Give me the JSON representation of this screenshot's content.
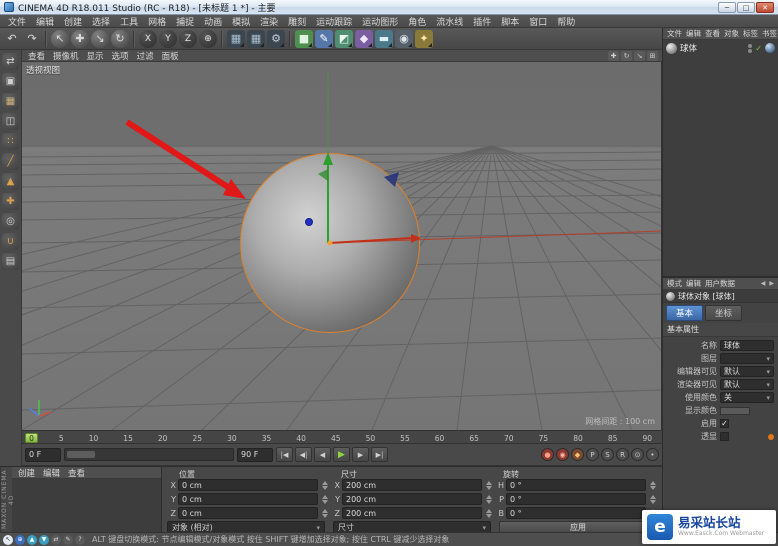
{
  "window": {
    "title": "CINEMA 4D R18.011 Studio (RC - R18) - [未标题 1 *] - 主要",
    "controls": {
      "min": "─",
      "max": "□",
      "close": "✕"
    }
  },
  "menubar": {
    "items": [
      "文件",
      "编辑",
      "创建",
      "选择",
      "工具",
      "网格",
      "捕捉",
      "动画",
      "模拟",
      "渲染",
      "雕刻",
      "运动跟踪",
      "运动图形",
      "角色",
      "流水线",
      "插件",
      "脚本",
      "窗口",
      "帮助"
    ]
  },
  "toolbar": {
    "buttons": [
      {
        "name": "undo-button",
        "g": "↶"
      },
      {
        "name": "redo-button",
        "g": "↷"
      },
      {
        "sep": true
      },
      {
        "name": "live-selection-button",
        "g": "↖",
        "circle": true
      },
      {
        "name": "move-tool-button",
        "g": "✚",
        "circle": true
      },
      {
        "name": "scale-tool-button",
        "g": "↘",
        "circle": true
      },
      {
        "name": "rotate-tool-button",
        "g": "↻",
        "circle": true
      },
      {
        "sep": true
      },
      {
        "name": "lock-x-axis-button",
        "g": "X",
        "circle": true,
        "dark": true
      },
      {
        "name": "lock-y-axis-button",
        "g": "Y",
        "circle": true,
        "dark": true
      },
      {
        "name": "lock-z-axis-button",
        "g": "Z",
        "circle": true,
        "dark": true
      },
      {
        "name": "coordinate-system-button",
        "g": "⊕",
        "circle": true,
        "dark": true
      },
      {
        "sep": true
      },
      {
        "name": "render-view-button",
        "g": "▦",
        "bg": "#3c4650",
        "fg": "#a8c0d2",
        "pal": true
      },
      {
        "name": "render-picture-viewer-button",
        "g": "▦",
        "bg": "#3c4650",
        "fg": "#a8c0d2",
        "pal": true
      },
      {
        "name": "render-settings-button",
        "g": "⚙",
        "bg": "#3c4650",
        "fg": "#c2cfd8",
        "pal": true
      },
      {
        "sep": true
      },
      {
        "name": "add-cube-button",
        "g": "■",
        "bg": "#4f8f4f",
        "fg": "#e2f2e2",
        "pal": true
      },
      {
        "name": "add-spline-button",
        "g": "✎",
        "bg": "#5577aa",
        "fg": "#ffffff",
        "pal": true
      },
      {
        "name": "add-subdivision-button",
        "g": "◩",
        "bg": "#4f8f6f",
        "fg": "#eaf6ee",
        "pal": true
      },
      {
        "name": "add-deformer-button",
        "g": "◆",
        "bg": "#7a5fa0",
        "fg": "#efe8f8",
        "pal": true
      },
      {
        "name": "add-floor-button",
        "g": "▬",
        "bg": "#4a7a8a",
        "fg": "#ddeef4",
        "pal": true
      },
      {
        "name": "add-camera-button",
        "g": "◉",
        "bg": "#55606a",
        "fg": "#dde4ea",
        "pal": true
      },
      {
        "name": "add-light-button",
        "g": "✦",
        "bg": "#8a7a3a",
        "fg": "#ffeaa6",
        "pal": true
      }
    ]
  },
  "left_toolbar": {
    "buttons": [
      {
        "name": "make-editable-button",
        "g": "⇄",
        "fg": "#d0d0d0"
      },
      {
        "name": "model-mode-button",
        "g": "▣",
        "fg": "#d0d0d0"
      },
      {
        "name": "texture-mode-button",
        "g": "▦",
        "fg": "#cdb57a"
      },
      {
        "name": "workplane-mode-button",
        "g": "◫",
        "fg": "#d0d0d0"
      },
      {
        "name": "points-mode-button",
        "g": "∷",
        "fg": "#dca24c"
      },
      {
        "name": "edges-mode-button",
        "g": "╱",
        "fg": "#dca24c"
      },
      {
        "name": "polygons-mode-button",
        "g": "▲",
        "fg": "#dca24c"
      },
      {
        "name": "enable-axis-button",
        "g": "✚",
        "fg": "#dca24c"
      },
      {
        "name": "viewport-solo-button",
        "g": "◎",
        "fg": "#d0d0d0"
      },
      {
        "name": "snap-enable-button",
        "g": "∪",
        "fg": "#dca24c"
      },
      {
        "name": "workplane-lock-button",
        "g": "▤",
        "fg": "#d0d0d0"
      }
    ]
  },
  "viewport": {
    "menu": [
      "查看",
      "摄像机",
      "显示",
      "选项",
      "过滤",
      "面板"
    ],
    "corner_icons": [
      {
        "name": "view-pan-icon",
        "g": "✚"
      },
      {
        "name": "view-rotate-icon",
        "g": "↻"
      },
      {
        "name": "view-zoom-icon",
        "g": "↘"
      },
      {
        "name": "view-maximize-icon",
        "g": "⊞"
      }
    ],
    "view_label": "透视视图",
    "grid_label": "网格间距 : 100 cm",
    "selected_object": "球体",
    "axis_colors": {
      "x": "#c23018",
      "y": "#2e9e2e",
      "z": "#2030c8"
    },
    "selection_color": "#e2822a"
  },
  "timeline": {
    "current": "0",
    "ticks": [
      "0",
      "5",
      "10",
      "15",
      "20",
      "25",
      "30",
      "35",
      "40",
      "45",
      "50",
      "55",
      "60",
      "65",
      "70",
      "75",
      "80",
      "85",
      "90"
    ]
  },
  "transport": {
    "start": "0 F",
    "end": "90 F",
    "buttons": [
      {
        "name": "goto-start-button",
        "g": "|◀"
      },
      {
        "name": "previous-key-button",
        "g": "◀|"
      },
      {
        "name": "previous-frame-button",
        "g": "◀"
      },
      {
        "name": "play-button",
        "g": "▶",
        "play": true
      },
      {
        "name": "next-frame-button",
        "g": "▶"
      },
      {
        "name": "goto-end-button",
        "g": "▶|"
      }
    ],
    "record_buttons": [
      {
        "name": "record-keyframe-button",
        "g": "●",
        "bg": "#8a3a30",
        "fg": "#ff9d8a"
      },
      {
        "name": "autokey-button",
        "g": "◉",
        "bg": "#8a3a30",
        "fg": "#ffb3a0"
      },
      {
        "name": "keyframe-selection-button",
        "g": "◆",
        "bg": "#7a4a30",
        "fg": "#ffc070"
      },
      {
        "name": "record-position-button",
        "g": "P",
        "bg": "#4e4e4e",
        "fg": "#d0d0d0"
      },
      {
        "name": "record-scale-button",
        "g": "S",
        "bg": "#4e4e4e",
        "fg": "#d0d0d0"
      },
      {
        "name": "record-rotation-button",
        "g": "R",
        "bg": "#4e4e4e",
        "fg": "#d0d0d0"
      },
      {
        "name": "record-parameter-button",
        "g": "⊙",
        "bg": "#4e4e4e",
        "fg": "#d0d0d0"
      },
      {
        "name": "record-point-level-button",
        "g": "•",
        "bg": "#4e4e4e",
        "fg": "#d0d0d0"
      }
    ]
  },
  "materials": {
    "menu": [
      "创建",
      "编辑",
      "查看"
    ]
  },
  "coordinates": {
    "pos_title": "位置",
    "size_title": "尺寸",
    "rot_title": "旋转",
    "rows": [
      {
        "pl": "X",
        "pv": "0 cm",
        "sl": "X",
        "sv": "200 cm",
        "rl": "H",
        "rv": "0 °"
      },
      {
        "pl": "Y",
        "pv": "0 cm",
        "sl": "Y",
        "sv": "200 cm",
        "rl": "P",
        "rv": "0 °"
      },
      {
        "pl": "Z",
        "pv": "0 cm",
        "sl": "Z",
        "sv": "200 cm",
        "rl": "B",
        "rv": "0 °"
      }
    ],
    "pos_mode": "对象 (相对)",
    "size_mode": "尺寸",
    "apply": "应用"
  },
  "objects": {
    "menu": [
      "文件",
      "编辑",
      "查看",
      "对象",
      "标签",
      "书签"
    ],
    "item_label": "球体"
  },
  "attributes": {
    "menu": [
      "模式",
      "编辑",
      "用户数据"
    ],
    "title": "球体对象 [球体]",
    "tabs": [
      {
        "label": "基本",
        "active": true
      },
      {
        "label": "坐标",
        "active": false
      }
    ],
    "section": "基本属性",
    "rows": [
      {
        "label": "名称",
        "value": "球体",
        "field": true
      },
      {
        "label": "图层",
        "value": "",
        "field": true,
        "dropdown": true
      },
      {
        "label": "编辑器可见",
        "value": "默认",
        "field": true,
        "dropdown": true
      },
      {
        "label": "渲染器可见",
        "value": "默认",
        "field": true,
        "dropdown": true
      },
      {
        "label": "使用颜色",
        "value": "关",
        "field": true,
        "dropdown": true
      },
      {
        "label": "显示颜色",
        "swatch": true
      },
      {
        "label": "启用",
        "checkbox": true,
        "checked": true
      },
      {
        "label": "透显",
        "checkbox": true,
        "checked": false,
        "keydot": true
      }
    ]
  },
  "statusbar": {
    "icons": [
      {
        "name": "status-pointer-icon",
        "g": "↖",
        "bg": "#e4eaf2",
        "fg": "#333333"
      },
      {
        "name": "status-globe-icon",
        "g": "⊕",
        "bg": "#3a6fbf",
        "fg": "#ffffff"
      },
      {
        "name": "status-up-icon",
        "g": "▲",
        "bg": "#3a9fbf",
        "fg": "#ffffff"
      },
      {
        "name": "status-down-icon",
        "g": "▼",
        "bg": "#3a9fbf",
        "fg": "#ffffff"
      },
      {
        "name": "status-link-icon",
        "g": "⇄",
        "bg": "#5a5a5a",
        "fg": "#dddddd"
      },
      {
        "name": "status-pen-icon",
        "g": "✎",
        "bg": "#5a5a5a",
        "fg": "#dddddd"
      },
      {
        "name": "status-help-icon",
        "g": "?",
        "bg": "#5a5a5a",
        "fg": "#dddddd"
      }
    ],
    "text": "ALT 键盘切换模式: 节点编辑模式/对象模式 按住 SHIFT 键增加选择对象; 按住 CTRL 键减少选择对象"
  },
  "brand": {
    "text": "MAXON  CINEMA 4D"
  },
  "watermark": {
    "logo": "e",
    "title": "易采站长站",
    "subtitle": "Www.Easck.Com Webmaster"
  }
}
